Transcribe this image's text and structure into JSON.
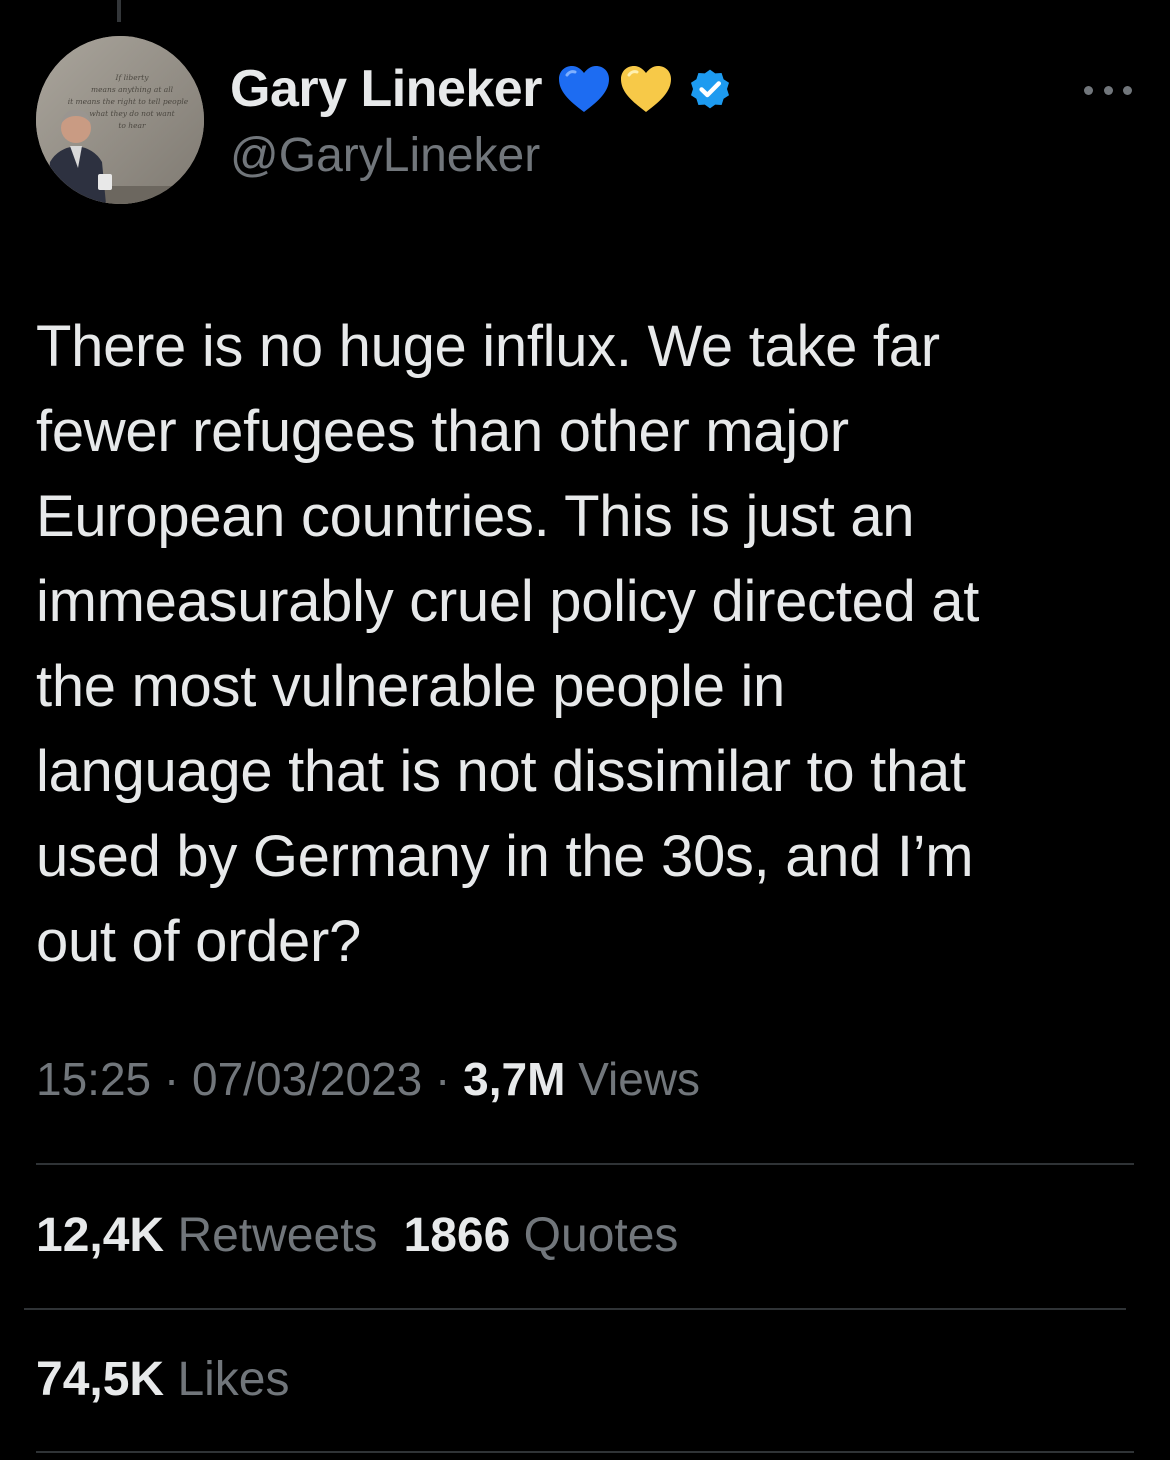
{
  "author": {
    "display_name": "Gary Lineker",
    "handle": "@GaryLineker",
    "badges": [
      "blue-heart-icon",
      "yellow-heart-icon",
      "verified-badge-icon"
    ],
    "avatar_sign_text": [
      "If liberty",
      "means anything at all",
      "it means the right to tell people",
      "what they do not want",
      "to hear"
    ]
  },
  "tweet": {
    "text": "There is no huge influx. We take far\nfewer refugees than other major\nEuropean countries. This is just an\nimmeasurably cruel policy directed at\nthe most vulnerable people in\nlanguage that is not dissimilar to that\nused by Germany in the 30s, and I’m\nout of order?",
    "time": "15:25",
    "separator": " · ",
    "date": "07/03/2023",
    "views_count": "3,7M",
    "views_label": "Views"
  },
  "stats": {
    "retweets_count": "12,4K",
    "retweets_label": "Retweets",
    "quotes_count": "1866",
    "quotes_label": "Quotes",
    "likes_count": "74,5K",
    "likes_label": "Likes"
  },
  "colors": {
    "background": "#000000",
    "primary_text": "#e7e9ea",
    "secondary_text": "#71767b",
    "divider": "#2f3336",
    "verified_blue": "#1d9bf0",
    "blue_heart": "#1d6cf2",
    "yellow_heart": "#f7c948"
  }
}
